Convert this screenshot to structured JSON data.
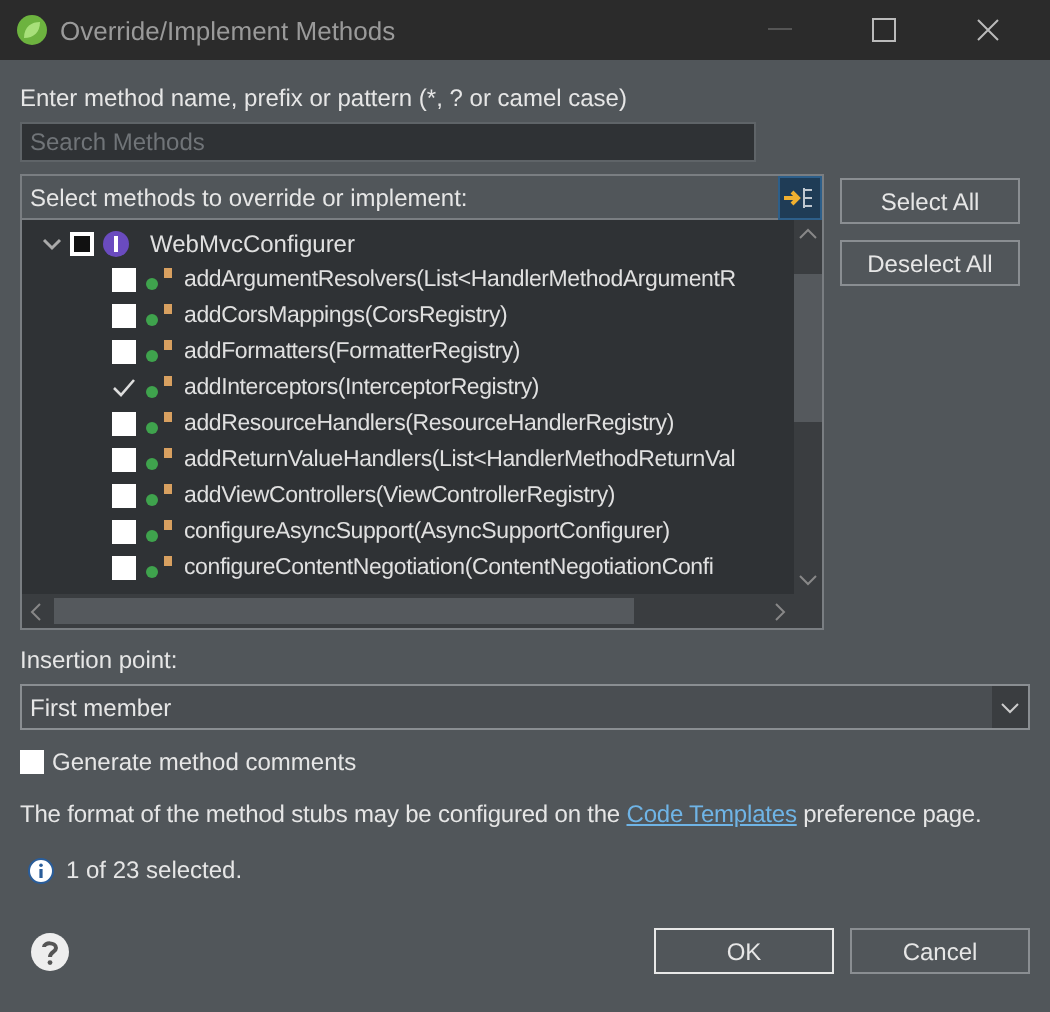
{
  "window": {
    "title": "Override/Implement Methods"
  },
  "search": {
    "label": "Enter method name, prefix or pattern (*, ? or camel case)",
    "placeholder": "Search Methods"
  },
  "tree": {
    "header": "Select methods to override or implement:",
    "root": {
      "label": "WebMvcConfigurer",
      "expanded": true,
      "checked": false,
      "children": [
        {
          "label": "addArgumentResolvers(List<HandlerMethodArgumentR",
          "checked": false
        },
        {
          "label": "addCorsMappings(CorsRegistry)",
          "checked": false
        },
        {
          "label": "addFormatters(FormatterRegistry)",
          "checked": false
        },
        {
          "label": "addInterceptors(InterceptorRegistry)",
          "checked": true
        },
        {
          "label": "addResourceHandlers(ResourceHandlerRegistry)",
          "checked": false
        },
        {
          "label": "addReturnValueHandlers(List<HandlerMethodReturnVal",
          "checked": false
        },
        {
          "label": "addViewControllers(ViewControllerRegistry)",
          "checked": false
        },
        {
          "label": "configureAsyncSupport(AsyncSupportConfigurer)",
          "checked": false
        },
        {
          "label": "configureContentNegotiation(ContentNegotiationConfi",
          "checked": false
        }
      ]
    }
  },
  "side_buttons": [
    "Select All",
    "Deselect All"
  ],
  "insertion": {
    "label": "Insertion point:",
    "value": "First member"
  },
  "generate_comments": {
    "label": "Generate method comments",
    "checked": false
  },
  "info": {
    "before": "The format of the method stubs may be configured on the",
    "link": "Code Templates",
    "after": "preference page."
  },
  "status": "1 of 23 selected.",
  "buttons": [
    "OK",
    "Cancel"
  ]
}
